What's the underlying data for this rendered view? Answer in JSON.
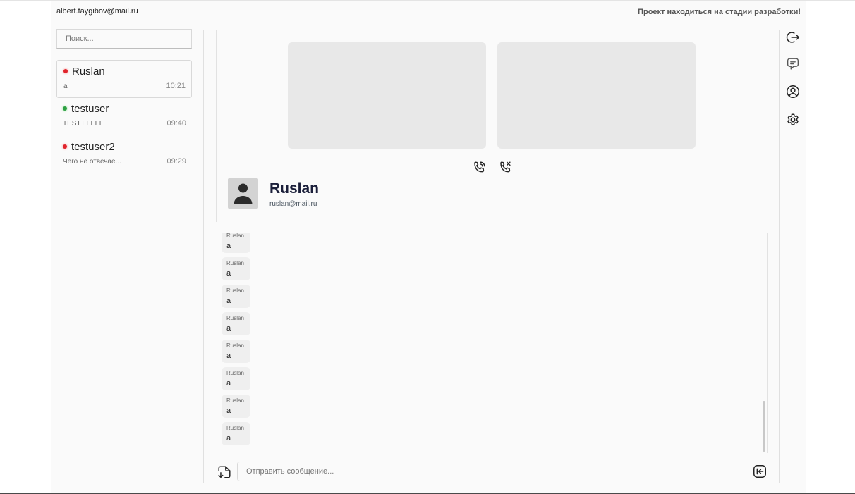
{
  "header": {
    "user_email": "albert.taygibov@mail.ru",
    "notice": "Проект находиться на стадии разработки!"
  },
  "search": {
    "placeholder": "Поиск..."
  },
  "contacts": [
    {
      "name": "Ruslan",
      "last_message": "a",
      "time": "10:21",
      "status_color": "#e0242c",
      "active": true
    },
    {
      "name": "testuser",
      "last_message": "TESTTTTTT",
      "time": "09:40",
      "status_color": "#2ea043",
      "active": false
    },
    {
      "name": "testuser2",
      "last_message": "Чего не отвечае...",
      "time": "09:29",
      "status_color": "#e0242c",
      "active": false
    }
  ],
  "call": {
    "peer_name": "Ruslan",
    "peer_email": "ruslan@mail.ru",
    "accept_icon": "phone-ringing-icon",
    "decline_icon": "phone-hangup-icon"
  },
  "messages": [
    {
      "author": "Ruslan",
      "text": "a"
    },
    {
      "author": "Ruslan",
      "text": "a"
    },
    {
      "author": "Ruslan",
      "text": "a"
    },
    {
      "author": "Ruslan",
      "text": "a"
    },
    {
      "author": "Ruslan",
      "text": "a"
    },
    {
      "author": "Ruslan",
      "text": "a"
    },
    {
      "author": "Ruslan",
      "text": "a"
    },
    {
      "author": "Ruslan",
      "text": "a"
    }
  ],
  "composer": {
    "placeholder": "Отправить сообщение..."
  },
  "sidebar_icons": [
    "logout-icon",
    "chat-icon",
    "profile-icon",
    "settings-icon"
  ]
}
